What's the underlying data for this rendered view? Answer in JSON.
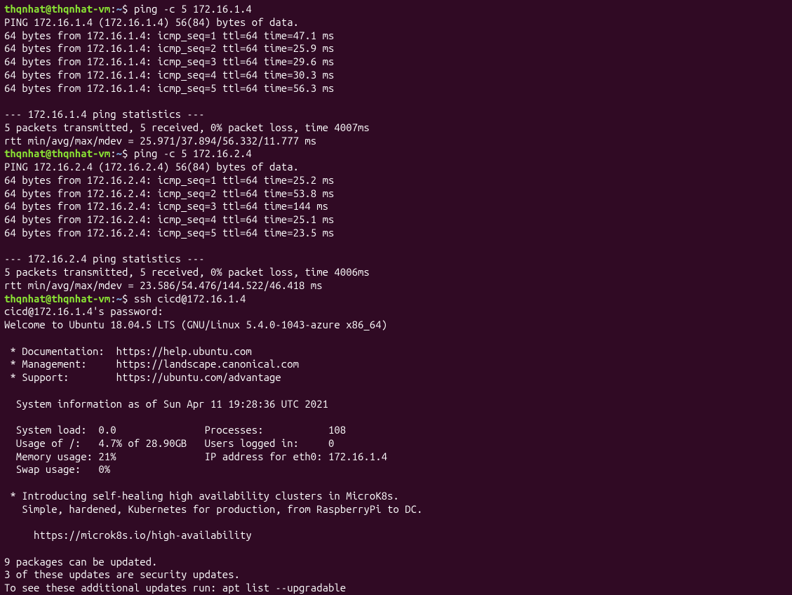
{
  "prompt1": {
    "user_host": "thqnhat@thqnhat-vm",
    "colon": ":",
    "path": "~",
    "dollar": "$ ",
    "command": "ping -c 5 172.16.1.4"
  },
  "ping1_output": [
    "PING 172.16.1.4 (172.16.1.4) 56(84) bytes of data.",
    "64 bytes from 172.16.1.4: icmp_seq=1 ttl=64 time=47.1 ms",
    "64 bytes from 172.16.1.4: icmp_seq=2 ttl=64 time=25.9 ms",
    "64 bytes from 172.16.1.4: icmp_seq=3 ttl=64 time=29.6 ms",
    "64 bytes from 172.16.1.4: icmp_seq=4 ttl=64 time=30.3 ms",
    "64 bytes from 172.16.1.4: icmp_seq=5 ttl=64 time=56.3 ms",
    "",
    "--- 172.16.1.4 ping statistics ---",
    "5 packets transmitted, 5 received, 0% packet loss, time 4007ms",
    "rtt min/avg/max/mdev = 25.971/37.894/56.332/11.777 ms"
  ],
  "prompt2": {
    "user_host": "thqnhat@thqnhat-vm",
    "colon": ":",
    "path": "~",
    "dollar": "$ ",
    "command": "ping -c 5 172.16.2.4"
  },
  "ping2_output": [
    "PING 172.16.2.4 (172.16.2.4) 56(84) bytes of data.",
    "64 bytes from 172.16.2.4: icmp_seq=1 ttl=64 time=25.2 ms",
    "64 bytes from 172.16.2.4: icmp_seq=2 ttl=64 time=53.8 ms",
    "64 bytes from 172.16.2.4: icmp_seq=3 ttl=64 time=144 ms",
    "64 bytes from 172.16.2.4: icmp_seq=4 ttl=64 time=25.1 ms",
    "64 bytes from 172.16.2.4: icmp_seq=5 ttl=64 time=23.5 ms",
    "",
    "--- 172.16.2.4 ping statistics ---",
    "5 packets transmitted, 5 received, 0% packet loss, time 4006ms",
    "rtt min/avg/max/mdev = 23.586/54.476/144.522/46.418 ms"
  ],
  "prompt3": {
    "user_host": "thqnhat@thqnhat-vm",
    "colon": ":",
    "path": "~",
    "dollar": "$ ",
    "command": "ssh cicd@172.16.1.4"
  },
  "ssh_output": [
    "cicd@172.16.1.4's password:",
    "Welcome to Ubuntu 18.04.5 LTS (GNU/Linux 5.4.0-1043-azure x86_64)",
    "",
    " * Documentation:  https://help.ubuntu.com",
    " * Management:     https://landscape.canonical.com",
    " * Support:        https://ubuntu.com/advantage",
    "",
    "  System information as of Sun Apr 11 19:28:36 UTC 2021",
    "",
    "  System load:  0.0               Processes:           108",
    "  Usage of /:   4.7% of 28.90GB   Users logged in:     0",
    "  Memory usage: 21%               IP address for eth0: 172.16.1.4",
    "  Swap usage:   0%",
    "",
    " * Introducing self-healing high availability clusters in MicroK8s.",
    "   Simple, hardened, Kubernetes for production, from RaspberryPi to DC.",
    "",
    "     https://microk8s.io/high-availability",
    "",
    "9 packages can be updated.",
    "3 of these updates are security updates.",
    "To see these additional updates run: apt list --upgradable"
  ]
}
